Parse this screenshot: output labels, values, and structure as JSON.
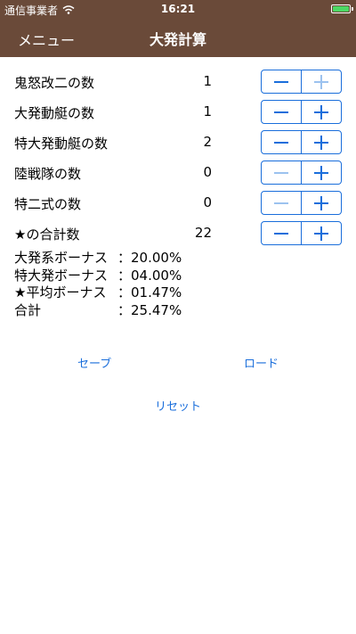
{
  "status": {
    "carrier": "通信事業者",
    "time": "16:21"
  },
  "nav": {
    "menu_label": "メニュー",
    "title": "大発計算"
  },
  "rows": [
    {
      "label": "鬼怒改二の数",
      "value": "1",
      "minus_enabled": true,
      "plus_enabled": false
    },
    {
      "label": "大発動艇の数",
      "value": "1",
      "minus_enabled": true,
      "plus_enabled": true
    },
    {
      "label": "特大発動艇の数",
      "value": "2",
      "minus_enabled": true,
      "plus_enabled": true
    },
    {
      "label": "陸戦隊の数",
      "value": "0",
      "minus_enabled": false,
      "plus_enabled": true
    },
    {
      "label": "特二式の数",
      "value": "0",
      "minus_enabled": false,
      "plus_enabled": true
    },
    {
      "label": "★の合計数",
      "value": "22",
      "minus_enabled": true,
      "plus_enabled": true
    }
  ],
  "bonus": [
    {
      "label": "大発系ボーナス",
      "value": "：20.00%"
    },
    {
      "label": "特大発ボーナス",
      "value": "：04.00%"
    },
    {
      "label": "★平均ボーナス",
      "value": "：01.47%"
    },
    {
      "label": "合計",
      "value": "：25.47%"
    }
  ],
  "buttons": {
    "save": "セーブ",
    "load": "ロード",
    "reset": "リセット"
  },
  "colors": {
    "nav_bg": "#6a4a39",
    "accent": "#1a6edb",
    "battery": "#4cd964"
  }
}
